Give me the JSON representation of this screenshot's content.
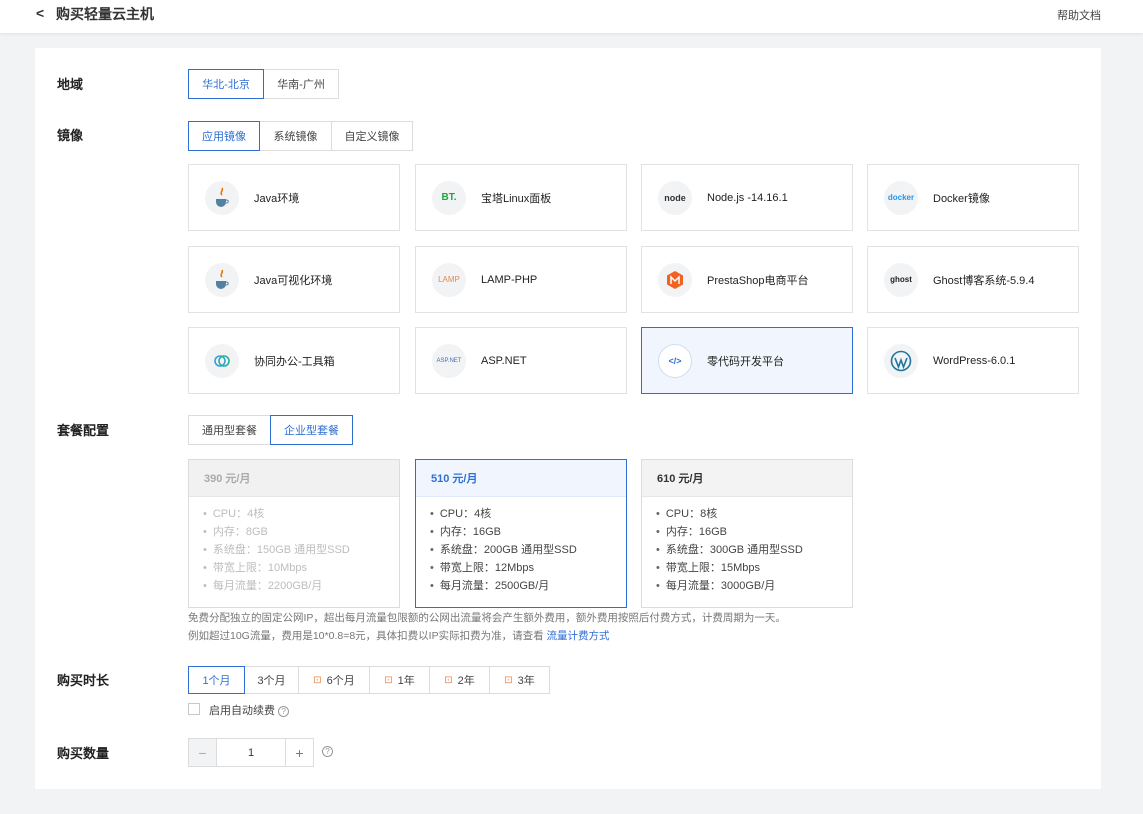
{
  "header": {
    "title": "购买轻量云主机",
    "help": "帮助文档"
  },
  "sections": {
    "region": "地域",
    "image": "镜像",
    "plan": "套餐配置",
    "duration": "购买时长",
    "quantity": "购买数量"
  },
  "regions": [
    {
      "label": "华北-北京",
      "active": true
    },
    {
      "label": "华南-广州",
      "active": false
    }
  ],
  "image_tabs": [
    {
      "label": "应用镜像",
      "active": true
    },
    {
      "label": "系统镜像",
      "active": false
    },
    {
      "label": "自定义镜像",
      "active": false
    }
  ],
  "images": [
    {
      "label": "Java环境",
      "icon": "java-icon"
    },
    {
      "label": "宝塔Linux面板",
      "icon": "bt-icon"
    },
    {
      "label": "Node.js -14.16.1",
      "icon": "nodejs-icon"
    },
    {
      "label": "Docker镜像",
      "icon": "docker-icon"
    },
    {
      "label": "Java可视化环境",
      "icon": "java-icon"
    },
    {
      "label": "LAMP-PHP",
      "icon": "lamp-icon"
    },
    {
      "label": "PrestaShop电商平台",
      "icon": "prestashop-icon"
    },
    {
      "label": "Ghost博客系统-5.9.4",
      "icon": "ghost-icon"
    },
    {
      "label": "协同办公-工具箱",
      "icon": "collab-icon"
    },
    {
      "label": "ASP.NET",
      "icon": "aspnet-icon"
    },
    {
      "label": "零代码开发平台",
      "icon": "lowcode-icon",
      "active": true
    },
    {
      "label": "WordPress-6.0.1",
      "icon": "wordpress-icon"
    }
  ],
  "icon_text": {
    "bt": "BT.",
    "node": "node",
    "docker": "docker",
    "lamp": "LAMP",
    "ghost": "ghost",
    "aspnet": "ASP.NET",
    "lowcode": "</>"
  },
  "plan_tabs": [
    {
      "label": "通用型套餐",
      "active": false
    },
    {
      "label": "企业型套餐",
      "active": true
    }
  ],
  "plans": [
    {
      "price": "390 元/月",
      "state": "disabled",
      "specs": [
        "CPU：4核",
        "内存：8GB",
        "系统盘：150GB 通用型SSD",
        "带宽上限：10Mbps",
        "每月流量：2200GB/月"
      ]
    },
    {
      "price": "510 元/月",
      "state": "active",
      "specs": [
        "CPU：4核",
        "内存：16GB",
        "系统盘：200GB 通用型SSD",
        "带宽上限：12Mbps",
        "每月流量：2500GB/月"
      ]
    },
    {
      "price": "610 元/月",
      "state": "normal",
      "specs": [
        "CPU：8核",
        "内存：16GB",
        "系统盘：300GB 通用型SSD",
        "带宽上限：15Mbps",
        "每月流量：3000GB/月"
      ]
    }
  ],
  "notes": {
    "line1": "免费分配独立的固定公网IP，超出每月流量包限额的公网出流量将会产生额外费用，额外费用按照后付费方式，计费周期为一天。",
    "line2": "例如超过10G流量，费用是10*0.8=8元，具体扣费以IP实际扣费为准，请查看 ",
    "link": "流量计费方式"
  },
  "durations": [
    {
      "label": "1个月",
      "active": true,
      "gift": false
    },
    {
      "label": "3个月",
      "active": false,
      "gift": false
    },
    {
      "label": "6个月",
      "active": false,
      "gift": true
    },
    {
      "label": "1年",
      "active": false,
      "gift": true
    },
    {
      "label": "2年",
      "active": false,
      "gift": true
    },
    {
      "label": "3年",
      "active": false,
      "gift": true
    }
  ],
  "auto_renew": {
    "label": "启用自动续费",
    "checked": false
  },
  "quantity": {
    "value": "1",
    "minus": "−",
    "plus": "+"
  },
  "glyphs": {
    "back": "<",
    "help": "?",
    "gift": "⊡"
  },
  "colors": {
    "accent": "#2f6fd4",
    "gift": "#e8884a"
  }
}
